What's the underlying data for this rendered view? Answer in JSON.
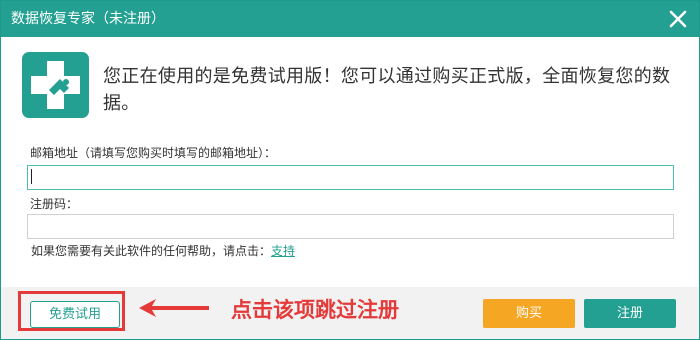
{
  "window": {
    "title": "数据恢复专家（未注册）",
    "close_icon": "close-icon"
  },
  "colors": {
    "accent": "#23a091",
    "buy": "#f5a623",
    "annotation": "#e53a3a"
  },
  "logo": {
    "icon": "medical-cross-logo-icon"
  },
  "message": "您正在使用的是免费试用版！您可以通过购买正式版，全面恢复您的数据。",
  "email": {
    "label": "邮箱地址（请填写您购买时填写的邮箱地址）：",
    "value": ""
  },
  "code": {
    "label": "注册码：",
    "value": ""
  },
  "help": {
    "text": "如果您需要有关此软件的任何帮助，请点击：",
    "link": "支持"
  },
  "buttons": {
    "free": "免费试用",
    "buy": "购买",
    "register": "注册"
  },
  "annotation": {
    "text": "点击该项跳过注册",
    "arrow_icon": "left-arrow-icon"
  }
}
